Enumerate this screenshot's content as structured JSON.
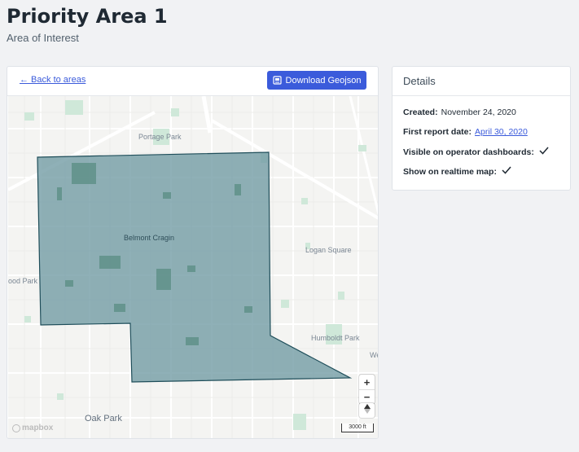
{
  "header": {
    "title": "Priority Area 1",
    "subtitle": "Area of Interest"
  },
  "map_card": {
    "back_label": "← Back to areas",
    "download_label": "Download Geojson",
    "accent_color": "#3b5bdb",
    "polygon_fill": "#6f9aa3",
    "polygon_stroke": "#1f4e5a",
    "labels": {
      "portage_park": "Portage Park",
      "belmont_cragin": "Belmont Cragin",
      "logan_square": "Logan Square",
      "ood_park": "ood Park",
      "humboldt_park": "Humboldt Park",
      "we": "We",
      "oak_park": "Oak Park"
    },
    "zoom_in": "+",
    "zoom_out": "−",
    "scale": "3000 ft",
    "attribution": "mapbox"
  },
  "details": {
    "title": "Details",
    "created_label": "Created:",
    "created_value": "November 24, 2020",
    "first_report_label": "First report date:",
    "first_report_value": "April 30, 2020",
    "visible_label": "Visible on operator dashboards:",
    "realtime_label": "Show on realtime map:",
    "check_icon": "check-icon"
  }
}
